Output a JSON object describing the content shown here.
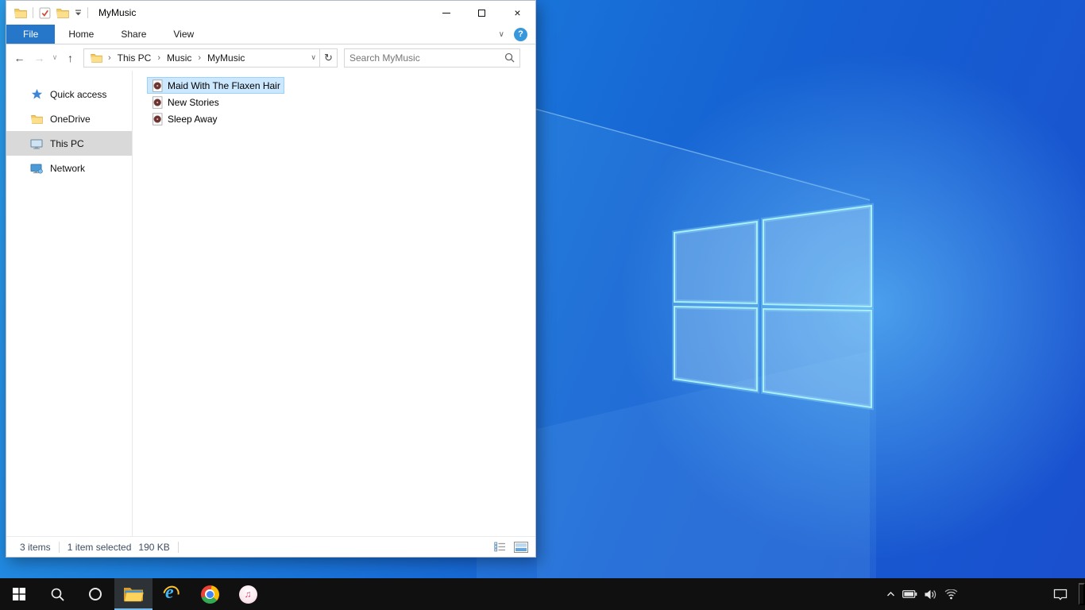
{
  "explorer": {
    "title": "MyMusic",
    "tabs": [
      {
        "label": "File",
        "active": true
      },
      {
        "label": "Home",
        "active": false
      },
      {
        "label": "Share",
        "active": false
      },
      {
        "label": "View",
        "active": false
      }
    ],
    "breadcrumb": {
      "segments": [
        "This PC",
        "Music",
        "MyMusic"
      ],
      "separator": "›"
    },
    "search": {
      "placeholder": "Search MyMusic"
    },
    "sidebar": {
      "items": [
        {
          "label": "Quick access",
          "icon": "quick-access-star",
          "selected": false
        },
        {
          "label": "OneDrive",
          "icon": "onedrive-folder",
          "selected": false
        },
        {
          "label": "This PC",
          "icon": "this-pc-monitor",
          "selected": true
        },
        {
          "label": "Network",
          "icon": "network-monitor",
          "selected": false
        }
      ]
    },
    "files": [
      {
        "name": "Maid With The Flaxen Hair",
        "icon": "music-file",
        "selected": true
      },
      {
        "name": "New Stories",
        "icon": "music-file",
        "selected": false
      },
      {
        "name": "Sleep Away",
        "icon": "music-file",
        "selected": false
      }
    ],
    "status": {
      "count": "3 items",
      "selected": "1 item selected",
      "size": "190 KB"
    }
  },
  "icons": {
    "back": "←",
    "forward": "→",
    "history_chevron": "∨",
    "up": "↑",
    "address_chevron": "∨",
    "refresh": "↻",
    "ribbon_collapse": "∨",
    "help": "?",
    "close": "×"
  },
  "taskbar": {
    "apps": [
      "start",
      "search",
      "cortana",
      "file-explorer",
      "internet-explorer",
      "chrome",
      "itunes"
    ],
    "tray": [
      "hidden-icons",
      "battery",
      "volume",
      "wifi",
      "action-center",
      "show-desktop"
    ],
    "ie_letter": "e",
    "itunes_note": "♫"
  },
  "colors": {
    "accent_tab_blue": "#2677c9",
    "file_selection_bg": "#cce8ff",
    "file_selection_border": "#99d1ff",
    "sidebar_selected_bg": "#d9d9d9",
    "taskbar_bg": "#101010",
    "taskbar_active_underline": "#76b9ed",
    "wallpaper_bright": "#2a9ae6",
    "wallpaper_dark": "#1a4fce",
    "logo_stroke": "#a9eef9"
  }
}
